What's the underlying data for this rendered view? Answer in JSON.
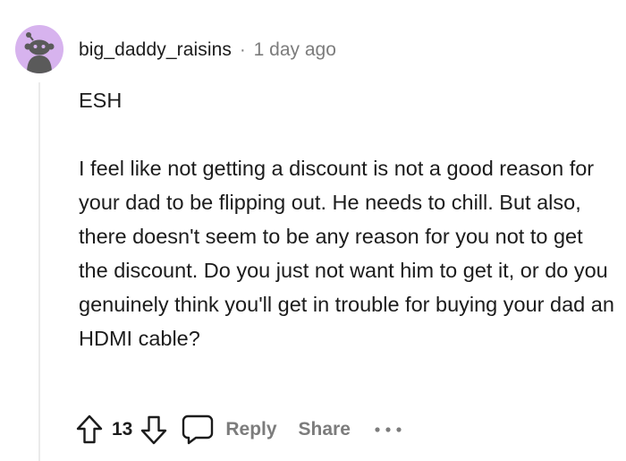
{
  "comment": {
    "username": "big_daddy_raisins",
    "separator": "·",
    "timestamp": "1 day ago",
    "paragraphs": [
      "ESH",
      "I feel like not getting a discount is not a good reason for your dad to be flipping out. He needs to chill. But also, there doesn't seem to be any reason for you not to get the discount. Do you just not want him to get it, or do you genuinely think you'll get in trouble for buying your dad an HDMI cable?"
    ],
    "score": "13",
    "reply_label": "Reply",
    "share_label": "Share"
  },
  "icons": {
    "avatar": "snoo-avatar-icon",
    "upvote": "upvote-arrow-icon",
    "downvote": "downvote-arrow-icon",
    "reply": "chat-bubble-icon",
    "more": "more-dots-icon"
  },
  "colors": {
    "avatar_bg": "#d7b3ee",
    "avatar_figure": "#5a5a5a",
    "text": "#1c1c1c",
    "meta": "#7c7c7c",
    "thread_line": "#ebebeb"
  }
}
